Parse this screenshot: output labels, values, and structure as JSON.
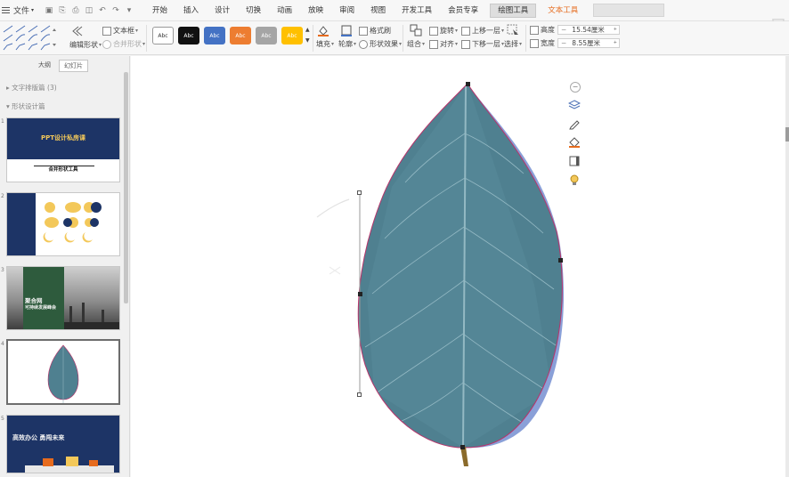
{
  "menubar": {
    "file_label": "文件",
    "tabs": [
      "开始",
      "插入",
      "设计",
      "切换",
      "动画",
      "放映",
      "审阅",
      "视图",
      "开发工具",
      "会员专享",
      "绘图工具",
      "文本工具"
    ],
    "active_tab_index": 10,
    "highlight_tab_index": 11,
    "brand_char": "吴"
  },
  "ribbon": {
    "text_box": "文本框",
    "edit_shape": "编辑形状",
    "merge_shape": "合并形状",
    "style_samples": [
      {
        "label": "Abc",
        "bg": "#ffffff",
        "fg": "#333333",
        "border": "#9a9a9a"
      },
      {
        "label": "Abc",
        "bg": "#111111",
        "fg": "#ffffff",
        "border": "#111111"
      },
      {
        "label": "Abc",
        "bg": "#4472c4",
        "fg": "#ffffff",
        "border": "#4472c4"
      },
      {
        "label": "Abc",
        "bg": "#ed7d31",
        "fg": "#ffffff",
        "border": "#ed7d31"
      },
      {
        "label": "Abc",
        "bg": "#a5a5a5",
        "fg": "#ffffff",
        "border": "#a5a5a5"
      },
      {
        "label": "Abc",
        "bg": "#ffc000",
        "fg": "#ffffff",
        "border": "#ffc000"
      }
    ],
    "fill": "填充",
    "outline": "轮廓",
    "format_painter": "格式刷",
    "shape_effects": "形状效果",
    "combine": "组合",
    "rotate": "旋转",
    "align": "对齐",
    "bring_forward": "上移一层",
    "send_backward": "下移一层",
    "select": "选择",
    "height_label": "高度",
    "height_value": "15.54厘米",
    "width_label": "宽度",
    "width_value": "8.55厘米"
  },
  "left_panel": {
    "tab_outline": "大纲",
    "tab_slides": "幻灯片",
    "section1": "文字排版篇 (3)",
    "section2": "形状设计篇",
    "slides": [
      {
        "num": "1",
        "title": "PPT设计私房课",
        "subtitle": "合并形状工具"
      },
      {
        "num": "2"
      },
      {
        "num": "3",
        "title1": "聚合网",
        "title2": "可持续发展峰会"
      },
      {
        "num": "4"
      },
      {
        "num": "5",
        "title": "高效办公 勇闯未来"
      }
    ]
  },
  "colors": {
    "accent_orange": "#e66b1e",
    "leaf": "#4f8090",
    "leaf_shadow": "#8aa0d8",
    "outline": "#b8336a",
    "navy": "#1d3466",
    "green_slide": "#2e5b3d",
    "yellow": "#f3c85a"
  },
  "icons": {
    "float_tools": [
      "minus-icon",
      "layers-icon",
      "pen-icon",
      "shape-fill-icon",
      "frame-icon",
      "bulb-icon"
    ]
  }
}
